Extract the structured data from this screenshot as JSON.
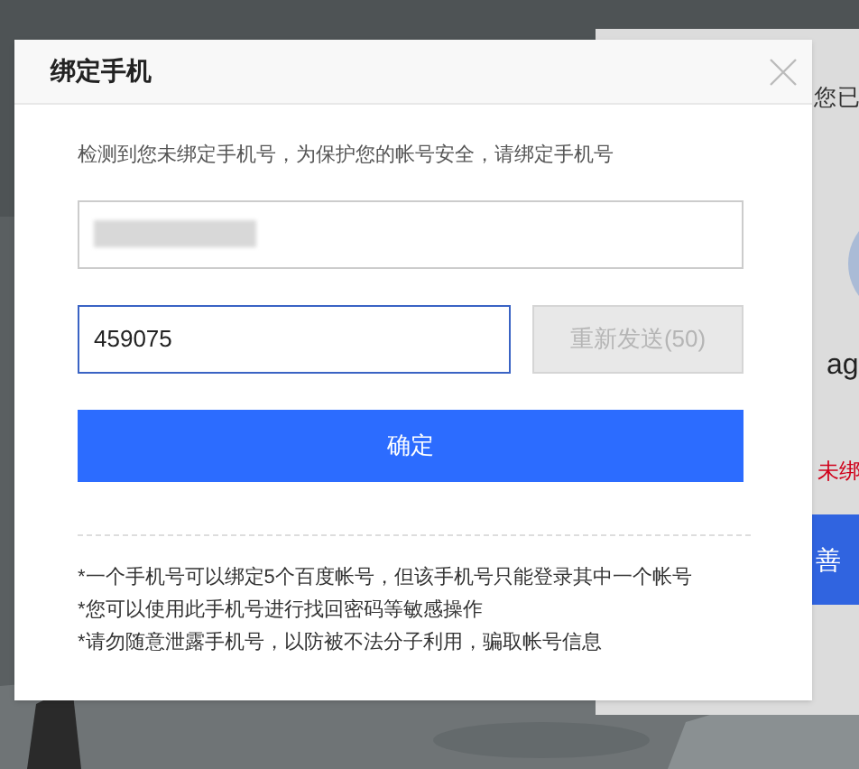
{
  "background_panel": {
    "greeting": "您已",
    "username": "ag",
    "warning": "未绑",
    "button": "善"
  },
  "dialog": {
    "title": "绑定手机",
    "message": "检测到您未绑定手机号，为保护您的帐号安全，请绑定手机号",
    "phone_field": {
      "redacted": true
    },
    "code_field": {
      "value": "459075",
      "focused": true
    },
    "resend_button": {
      "label": "重新发送(50)",
      "disabled": true
    },
    "confirm_button": {
      "label": "确定"
    },
    "notes": [
      "*一个手机号可以绑定5个百度帐号，但该手机号只能登录其中一个帐号",
      "*您可以使用此手机号进行找回密码等敏感操作",
      "*请勿随意泄露手机号，以防被不法分子利用，骗取帐号信息"
    ]
  }
}
